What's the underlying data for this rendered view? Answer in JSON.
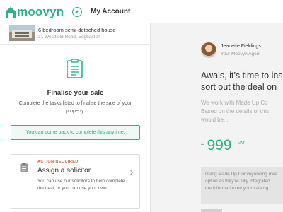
{
  "colors": {
    "brand": "#2bb389",
    "action_required": "#e05a2b"
  },
  "header": {
    "logo_text": "moovyn",
    "tab": {
      "label": "My Account",
      "icon": "compass-icon"
    }
  },
  "property": {
    "title": "6 bedroom semi-detached house",
    "address": "31 Westfield Road, Edgbaston"
  },
  "finalise": {
    "icon": "clipboard-icon",
    "title": "Finalise your sale",
    "description": "Complete the tasks listed to finalise the sale of your property."
  },
  "notice": "You can come back to complete this anytime.",
  "action_card": {
    "badge": "ACTION REQUIRED",
    "title": "Assign a solicitor",
    "description": "You can use our solicitors to help complete the deal, or you can use your own.",
    "icon": "clipboard-icon"
  },
  "agent": {
    "name": "Jeanette Fieldings",
    "role": "Your Moovyn Agent"
  },
  "main": {
    "headline_line1": "Awais, it’s time to ins",
    "headline_line2": "sort out the deal on",
    "body_line1": "We work with Made Up Co",
    "body_line2": "Based on the details of this",
    "body_line3": "would be...",
    "price_currency": "£",
    "price_amount": "999",
    "price_suffix": "+ VAT",
    "info_line1": "Using Made Up Conveyancing mea",
    "info_line2": "option as they’re fully integrated",
    "info_line3": "the information on your sale rig"
  }
}
